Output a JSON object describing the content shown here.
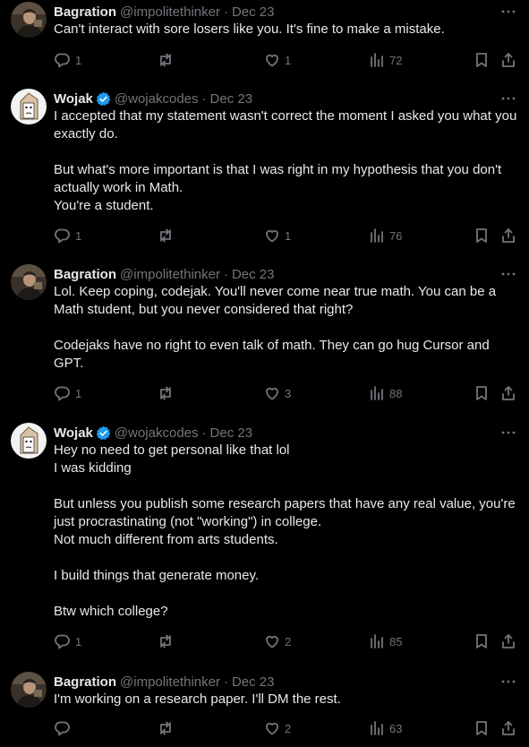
{
  "tweets": [
    {
      "author": "Bagration",
      "handle": "@impolitethinker",
      "separator": "·",
      "date": "Dec 23",
      "text": "Can't interact with sore losers like you. It's fine to make a mistake.",
      "replies": "1",
      "reposts": "",
      "likes": "1",
      "views": "72",
      "verified": false
    },
    {
      "author": "Wojak",
      "handle": "@wojakcodes",
      "separator": "·",
      "date": "Dec 23",
      "text": "I accepted that my statement wasn't correct the moment I asked you what you exactly do.\n\nBut what's more important is that I was right in my hypothesis that you don't actually work in Math.\nYou're a student.",
      "replies": "1",
      "reposts": "",
      "likes": "1",
      "views": "76",
      "verified": true
    },
    {
      "author": "Bagration",
      "handle": "@impolitethinker",
      "separator": "·",
      "date": "Dec 23",
      "text": "Lol. Keep coping, codejak. You'll never come near true math. You can be a Math student, but you never considered that right?\n\nCodejaks have no right to even talk of math. They can go hug Cursor and GPT.",
      "replies": "1",
      "reposts": "",
      "likes": "3",
      "views": "88",
      "verified": false
    },
    {
      "author": "Wojak",
      "handle": "@wojakcodes",
      "separator": "·",
      "date": "Dec 23",
      "text": "Hey no need to get personal like that lol\nI was kidding\n\nBut unless you publish some research papers that have any real value, you're just procrastinating (not \"working\") in college.\nNot much different from arts students.\n\nI build things that generate money.\n\nBtw which college?",
      "replies": "1",
      "reposts": "",
      "likes": "2",
      "views": "85",
      "verified": true
    },
    {
      "author": "Bagration",
      "handle": "@impolitethinker",
      "separator": "·",
      "date": "Dec 23",
      "text": "I'm working on a research paper. I'll DM the rest.",
      "replies": "",
      "reposts": "",
      "likes": "2",
      "views": "63",
      "verified": false
    }
  ],
  "icons": {
    "verified": "verified-badge-icon",
    "more": "more-icon",
    "reply": "reply-icon",
    "repost": "repost-icon",
    "like": "like-icon",
    "views": "views-icon",
    "bookmark": "bookmark-icon",
    "share": "share-icon"
  },
  "colors": {
    "background": "#000000",
    "text": "#e7e9ea",
    "muted": "#71767b",
    "verified": "#1d9bf0",
    "thread_line": "#333639"
  }
}
